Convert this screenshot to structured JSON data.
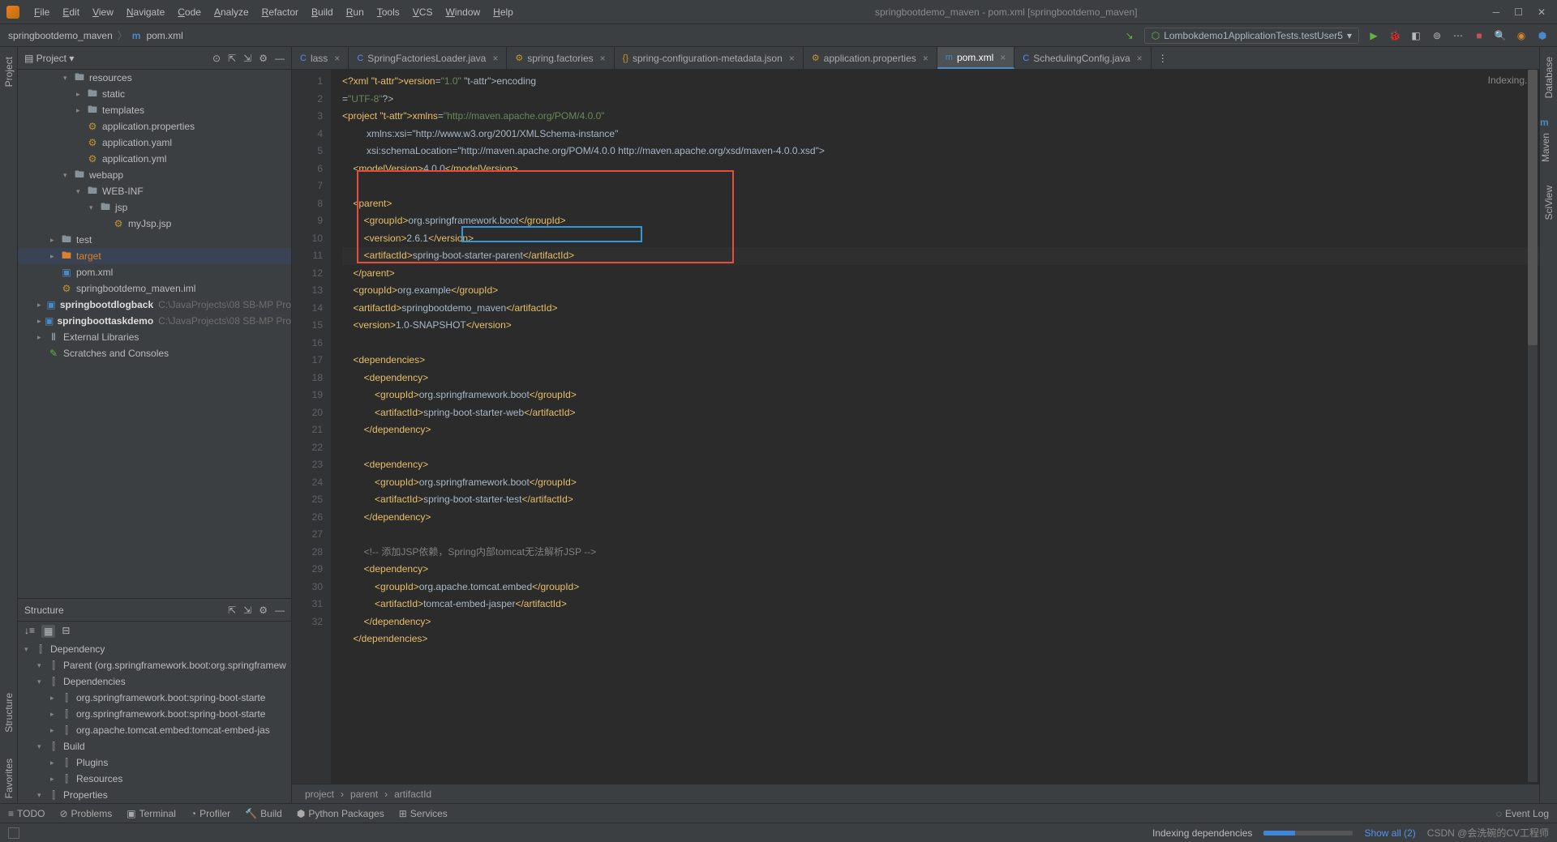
{
  "menu": {
    "items": [
      "File",
      "Edit",
      "View",
      "Navigate",
      "Code",
      "Analyze",
      "Refactor",
      "Build",
      "Run",
      "Tools",
      "VCS",
      "Window",
      "Help"
    ],
    "title": "springbootdemo_maven - pom.xml [springbootdemo_maven]"
  },
  "nav": {
    "crumb1": "springbootdemo_maven",
    "crumb2": "pom.xml",
    "runconfig": "Lombokdemo1ApplicationTests.testUser5"
  },
  "projectPanel": {
    "title": "Project"
  },
  "tree": [
    {
      "d": 3,
      "a": "v",
      "ic": "folder",
      "t": "resources"
    },
    {
      "d": 4,
      "a": ">",
      "ic": "folder",
      "t": "static"
    },
    {
      "d": 4,
      "a": ">",
      "ic": "folder",
      "t": "templates"
    },
    {
      "d": 4,
      "a": "",
      "ic": "cfg",
      "t": "application.properties"
    },
    {
      "d": 4,
      "a": "",
      "ic": "cfg",
      "t": "application.yaml"
    },
    {
      "d": 4,
      "a": "",
      "ic": "cfg",
      "t": "application.yml"
    },
    {
      "d": 3,
      "a": "v",
      "ic": "folder",
      "t": "webapp"
    },
    {
      "d": 4,
      "a": "v",
      "ic": "folder",
      "t": "WEB-INF"
    },
    {
      "d": 5,
      "a": "v",
      "ic": "folder",
      "t": "jsp"
    },
    {
      "d": 6,
      "a": "",
      "ic": "cfg",
      "t": "myJsp.jsp"
    },
    {
      "d": 2,
      "a": ">",
      "ic": "folder",
      "t": "test"
    },
    {
      "d": 2,
      "a": ">",
      "ic": "target",
      "t": "target",
      "orange": true,
      "sel": true
    },
    {
      "d": 2,
      "a": "",
      "ic": "mod",
      "t": "pom.xml"
    },
    {
      "d": 2,
      "a": "",
      "ic": "cfg",
      "t": "springbootdemo_maven.iml"
    },
    {
      "d": 1,
      "a": ">",
      "ic": "mod",
      "t": "springbootdlogback",
      "dim": "C:\\JavaProjects\\08 SB-MP Pro",
      "bold": true
    },
    {
      "d": 1,
      "a": ">",
      "ic": "mod",
      "t": "springboottaskdemo",
      "dim": "C:\\JavaProjects\\08 SB-MP Pro",
      "bold": true
    },
    {
      "d": 1,
      "a": ">",
      "ic": "lib",
      "t": "External Libraries"
    },
    {
      "d": 1,
      "a": "",
      "ic": "scratch",
      "t": "Scratches and Consoles"
    }
  ],
  "structure": {
    "title": "Structure",
    "items": [
      {
        "d": 0,
        "a": "v",
        "t": "Dependency"
      },
      {
        "d": 1,
        "a": "v",
        "t": "Parent (org.springframework.boot:org.springframew"
      },
      {
        "d": 1,
        "a": "v",
        "t": "Dependencies"
      },
      {
        "d": 2,
        "a": ">",
        "t": "org.springframework.boot:spring-boot-starte"
      },
      {
        "d": 2,
        "a": ">",
        "t": "org.springframework.boot:spring-boot-starte"
      },
      {
        "d": 2,
        "a": ">",
        "t": "org.apache.tomcat.embed:tomcat-embed-jas"
      },
      {
        "d": 1,
        "a": "v",
        "t": "Build"
      },
      {
        "d": 2,
        "a": ">",
        "t": "Plugins"
      },
      {
        "d": 2,
        "a": ">",
        "t": "Resources"
      },
      {
        "d": 1,
        "a": "v",
        "t": "Properties"
      }
    ]
  },
  "tabs": [
    {
      "label": "lass",
      "ic": "C",
      "active": false
    },
    {
      "label": "SpringFactoriesLoader.java",
      "ic": "C",
      "active": false
    },
    {
      "label": "spring.factories",
      "ic": "⚙",
      "active": false
    },
    {
      "label": "spring-configuration-metadata.json",
      "ic": "{}",
      "active": false
    },
    {
      "label": "application.properties",
      "ic": "⚙",
      "active": false
    },
    {
      "label": "pom.xml",
      "ic": "m",
      "active": true
    },
    {
      "label": "SchedulingConfig.java",
      "ic": "C",
      "active": false
    }
  ],
  "indexing": "Indexing...",
  "breadcrumb": [
    "project",
    "parent",
    "artifactId"
  ],
  "bottom": [
    "TODO",
    "Problems",
    "Terminal",
    "Profiler",
    "Build",
    "Python Packages",
    "Services"
  ],
  "eventlog": "Event Log",
  "status": {
    "task": "Indexing dependencies",
    "showall": "Show all (2)",
    "watermark": "CSDN @会洗碗的CV工程师"
  },
  "rightTabs": [
    "Database",
    "Maven",
    "SciView"
  ],
  "leftTabs": [
    "Project",
    "Structure",
    "Favorites"
  ],
  "code": {
    "startLine": 1,
    "lines": [
      "<?xml version=\"1.0\" encoding=\"UTF-8\"?>",
      "<project xmlns=\"http://maven.apache.org/POM/4.0.0\"",
      "         xmlns:xsi=\"http://www.w3.org/2001/XMLSchema-instance\"",
      "         xsi:schemaLocation=\"http://maven.apache.org/POM/4.0.0 http://maven.apache.org/xsd/maven-4.0.0.xsd\">",
      "    <modelVersion>4.0.0</modelVersion>",
      "",
      "    <parent>",
      "        <groupId>org.springframework.boot</groupId>",
      "        <version>2.6.1</version>",
      "        <artifactId>spring-boot-starter-parent</artifactId>",
      "    </parent>",
      "    <groupId>org.example</groupId>",
      "    <artifactId>springbootdemo_maven</artifactId>",
      "    <version>1.0-SNAPSHOT</version>",
      "",
      "    <dependencies>",
      "        <dependency>",
      "            <groupId>org.springframework.boot</groupId>",
      "            <artifactId>spring-boot-starter-web</artifactId>",
      "        </dependency>",
      "",
      "        <dependency>",
      "            <groupId>org.springframework.boot</groupId>",
      "            <artifactId>spring-boot-starter-test</artifactId>",
      "        </dependency>",
      "",
      "        <!-- 添加JSP依赖，Spring内部tomcat无法解析JSP -->",
      "        <dependency>",
      "            <groupId>org.apache.tomcat.embed</groupId>",
      "            <artifactId>tomcat-embed-jasper</artifactId>",
      "        </dependency>",
      "    </dependencies>"
    ]
  }
}
